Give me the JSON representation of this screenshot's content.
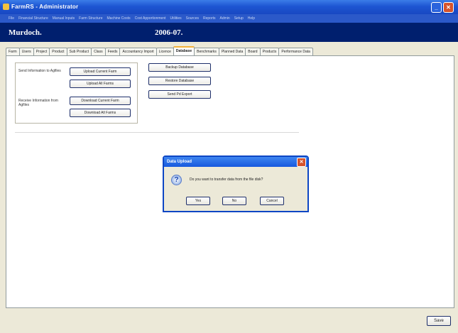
{
  "window": {
    "title": "FarmRS - Administrator",
    "min_icon": "minimize-icon",
    "close_icon": "close-icon"
  },
  "menubar": {
    "items": [
      "File",
      "Financial Structure",
      "Manual Inputs",
      "Farm Structure",
      "Machine Costs",
      "Cost Apportionment",
      "Utilities",
      "Sources",
      "Reports",
      "Admin",
      "Setup",
      "Help"
    ]
  },
  "brand": {
    "name": "Murdoch.",
    "year": "2006-07."
  },
  "tabs": [
    "Farm",
    "Users",
    "Project",
    "Product",
    "Sub Product",
    "Class",
    "Feeds",
    "Accountancy Import",
    "Licence",
    "Database",
    "Benchmarks",
    "Planned Data",
    "Board",
    "Products",
    "Performance Data"
  ],
  "active_tab": "Database",
  "groups": {
    "send": {
      "label": "Send Information to Agfiles",
      "btn1": "Upload Current Farm",
      "btn2": "Upload All Farms"
    },
    "receive": {
      "label": "Receive Information from Agfiles",
      "btn1": "Download Current Farm",
      "btn2": "Download All Farms"
    }
  },
  "db_buttons": {
    "backup": "Backup Database",
    "restore": "Restore Database",
    "export": "Send Pd Export"
  },
  "dialog": {
    "title": "Data Upload",
    "message": "Do you want to transfer data from the file disk?",
    "yes": "Yes",
    "no": "No",
    "cancel": "Cancel",
    "icon": "question-icon"
  },
  "footer": {
    "save": "Save"
  }
}
